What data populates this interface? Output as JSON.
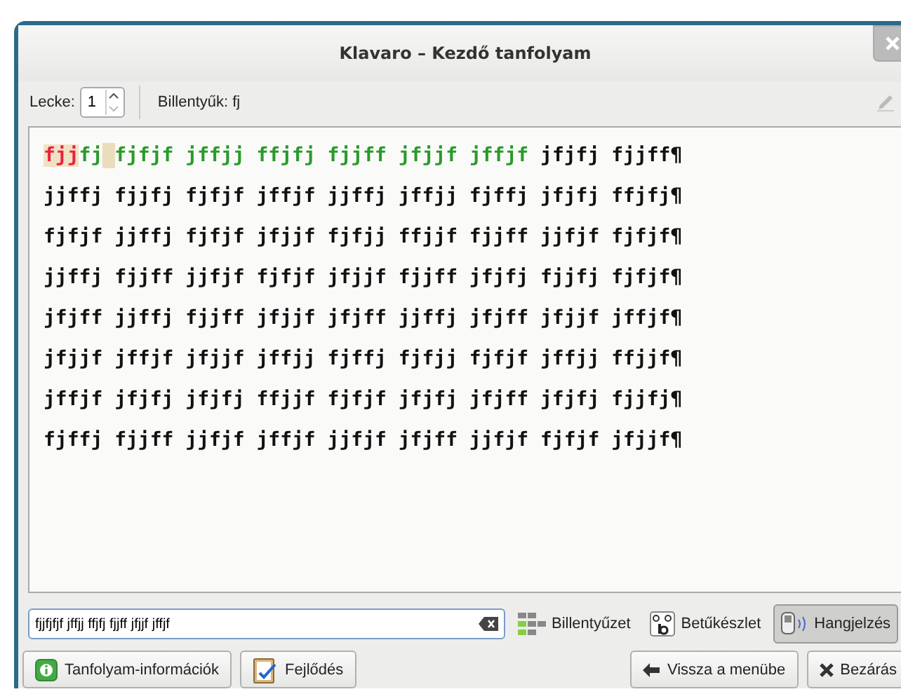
{
  "window": {
    "title": "Klavaro – Kezdő tanfolyam"
  },
  "toolbar": {
    "lesson_label": "Lecke:",
    "lesson_value": "1",
    "keys_label": "Billentyűk: fj"
  },
  "text": {
    "lines": [
      [
        {
          "kind": "error",
          "text": "fjj"
        },
        {
          "kind": "correct",
          "text": "fj"
        },
        {
          "kind": "cursor"
        },
        {
          "kind": "correct",
          "text": "fjfjf jffjj ffjfj fjjff jfjjf jffjf"
        },
        {
          "kind": "pending",
          "text": " jfjfj fjjff¶"
        }
      ],
      [
        {
          "kind": "pending",
          "text": "jjffj fjjfj fjfjf jffjf jjffj jffjj fjffj jfjfj ffjfj¶"
        }
      ],
      [
        {
          "kind": "pending",
          "text": "fjfjf jjffj fjfjf jfjjf fjfjj ffjjf fjjff jjfjf fjfjf¶"
        }
      ],
      [
        {
          "kind": "pending",
          "text": "jjffj fjjff jjfjf fjfjf jfjjf fjjff jfjfj fjjfj fjfjf¶"
        }
      ],
      [
        {
          "kind": "pending",
          "text": "jfjff jjffj fjjff jfjjf jfjff jjffj jfjff jfjjf jffjf¶"
        }
      ],
      [
        {
          "kind": "pending",
          "text": "jfjjf jffjf jfjjf jffjj fjffj fjfjj fjfjf jffjj ffjjf¶"
        }
      ],
      [
        {
          "kind": "pending",
          "text": "jffjf jfjfj jfjfj ffjjf fjfjf jfjfj jfjff jfjfj fjjfj¶"
        }
      ],
      [
        {
          "kind": "pending",
          "text": "fjffj fjjff jjfjf jffjf jjfjf jfjff jjfjf fjfjf jfjjf¶"
        }
      ]
    ]
  },
  "entry": {
    "value": "fjjfjfjf jffjj ffjfj fjjff jfjjf jffjf"
  },
  "toggles": [
    {
      "kind": "keyboard",
      "label": "Billentyűzet",
      "on": false
    },
    {
      "kind": "font",
      "label": "Betűkészlet",
      "on": false
    },
    {
      "kind": "sound",
      "label": "Hangjelzés",
      "on": true
    }
  ],
  "buttons_left": [
    {
      "kind": "info",
      "label": "Tanfolyam-információk"
    },
    {
      "kind": "progress",
      "label": "Fejlődés"
    }
  ],
  "buttons_right": [
    {
      "kind": "back",
      "label": "Vissza a menübe"
    },
    {
      "kind": "close",
      "label": "Bezárás"
    }
  ]
}
